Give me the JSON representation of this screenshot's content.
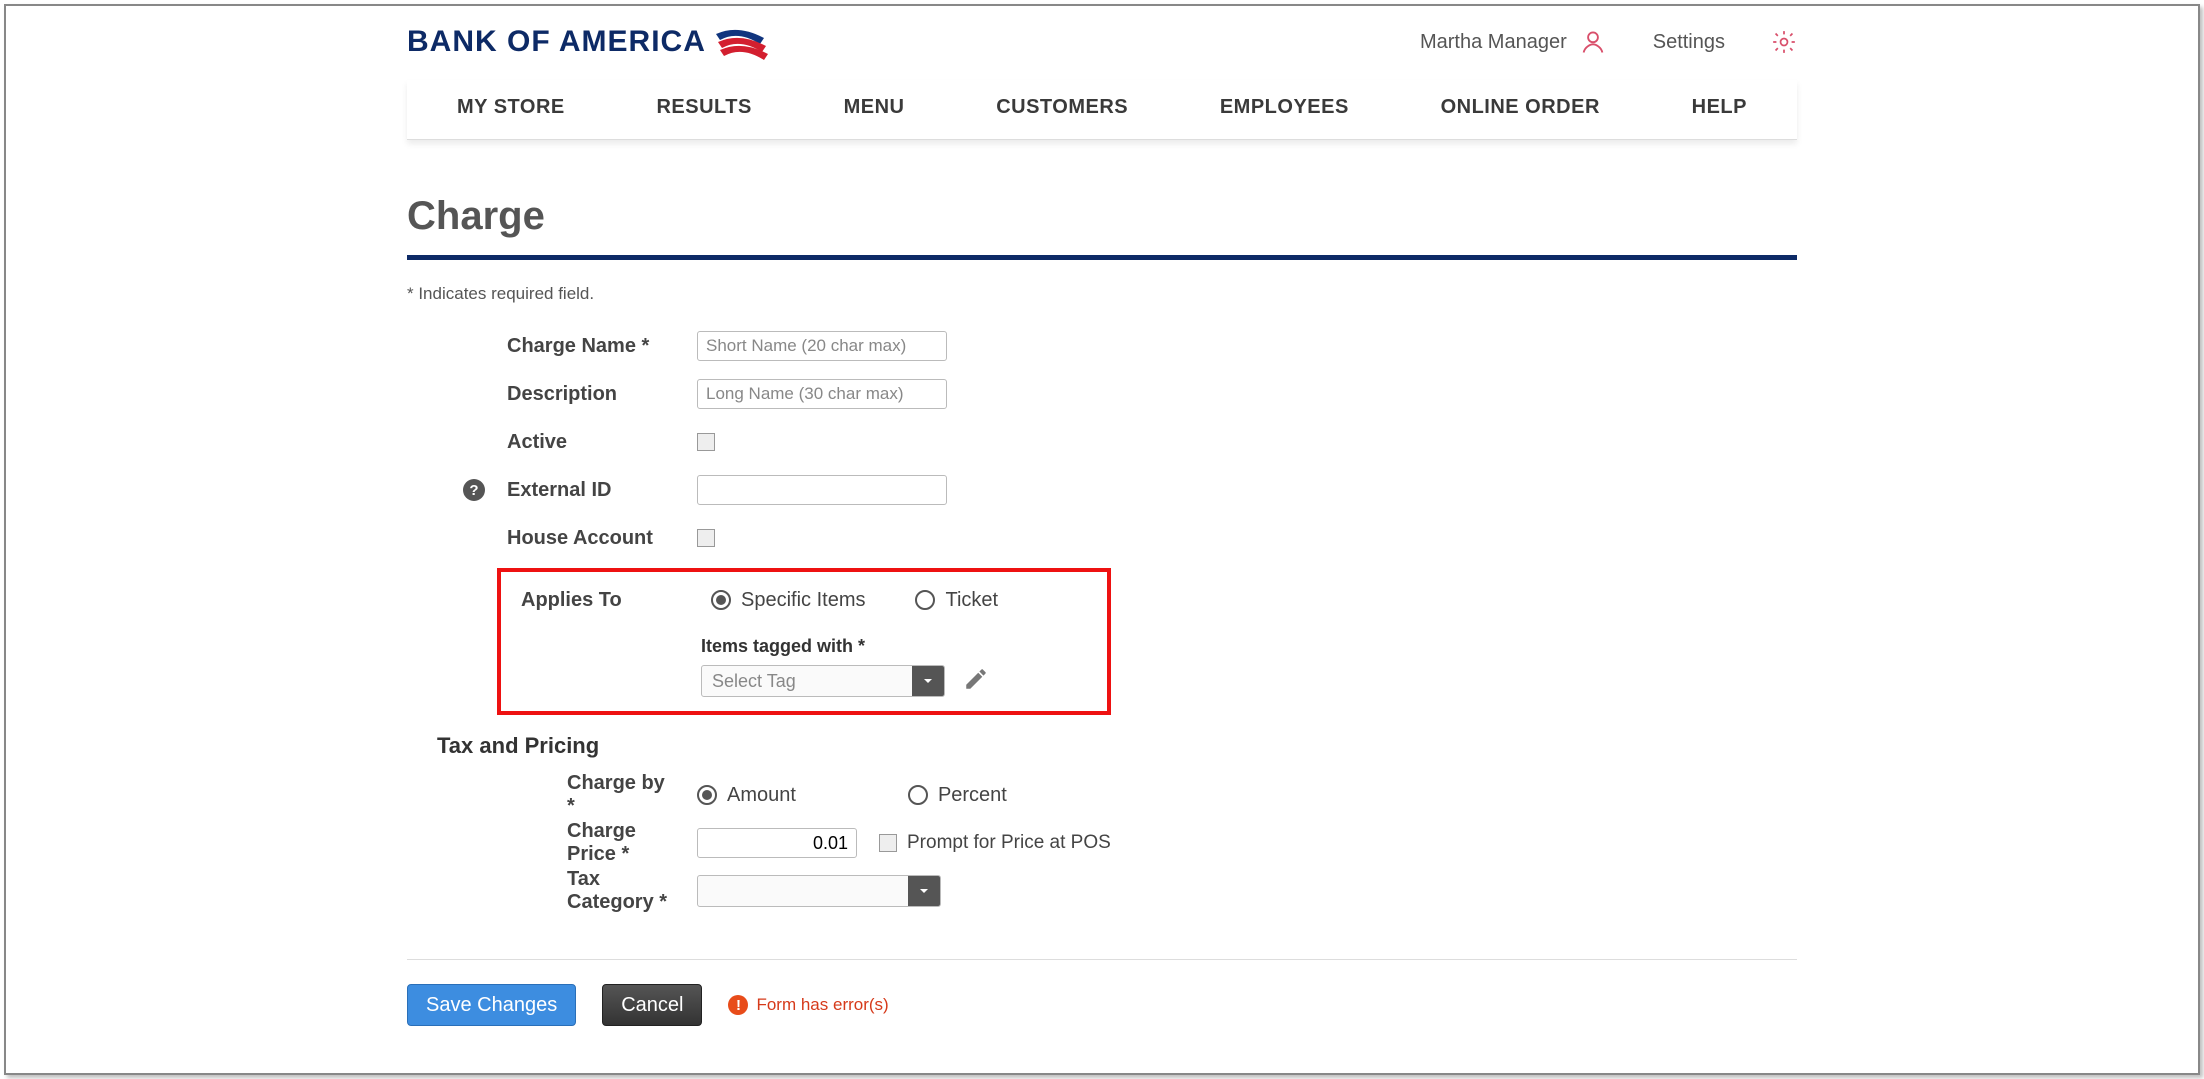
{
  "header": {
    "logo_text": "BANK OF AMERICA",
    "user_name": "Martha Manager",
    "settings_label": "Settings"
  },
  "nav": {
    "items": [
      "MY STORE",
      "RESULTS",
      "MENU",
      "CUSTOMERS",
      "EMPLOYEES",
      "ONLINE ORDER",
      "HELP"
    ]
  },
  "page": {
    "title": "Charge",
    "required_note": "* Indicates required field."
  },
  "form": {
    "charge_name": {
      "label": "Charge Name *",
      "placeholder": "Short Name (20 char max)",
      "value": ""
    },
    "description": {
      "label": "Description",
      "placeholder": "Long Name (30 char max)",
      "value": ""
    },
    "active": {
      "label": "Active",
      "checked": false
    },
    "external_id": {
      "label": "External ID",
      "value": ""
    },
    "house_account": {
      "label": "House Account",
      "checked": false
    },
    "applies_to": {
      "label": "Applies To",
      "options": {
        "specific_items": "Specific Items",
        "ticket": "Ticket"
      },
      "selected": "specific_items",
      "items_tagged_label": "Items tagged with *",
      "select_placeholder": "Select Tag"
    },
    "tax_pricing_heading": "Tax and Pricing",
    "charge_by": {
      "label": "Charge by *",
      "options": {
        "amount": "Amount",
        "percent": "Percent"
      },
      "selected": "amount"
    },
    "charge_price": {
      "label": "Charge Price *",
      "value": "0.01",
      "prompt_label": "Prompt for Price at POS",
      "prompt_checked": false
    },
    "tax_category": {
      "label": "Tax Category *",
      "value": ""
    }
  },
  "footer": {
    "save_label": "Save Changes",
    "cancel_label": "Cancel",
    "error_text": "Form has error(s)"
  }
}
